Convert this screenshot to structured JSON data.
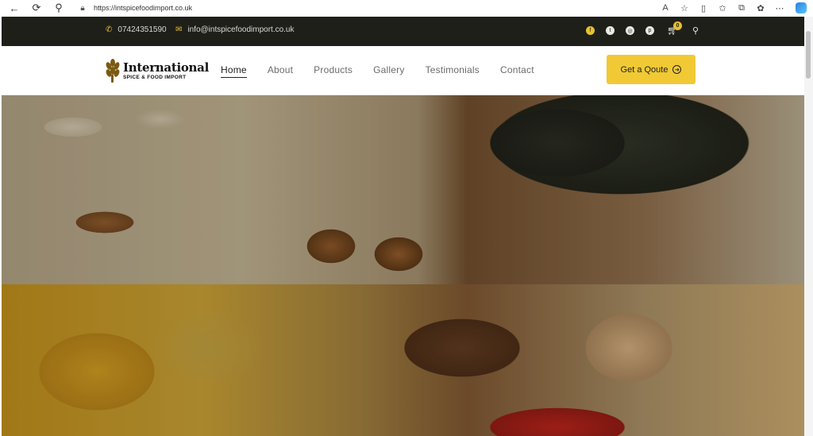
{
  "browser": {
    "url": "https://intspicefoodimport.co.uk",
    "icons": [
      "back-icon",
      "reload-icon",
      "search-icon",
      "lock-icon",
      "read-aloud-icon",
      "favorite-icon",
      "split-screen-icon",
      "favorites-icon",
      "collections-icon",
      "extensions-icon",
      "more-icon",
      "copilot-icon"
    ]
  },
  "topbar": {
    "phone": "07424351590",
    "email": "info@intspicefoodimport.co.uk",
    "cart_count": "0",
    "social": [
      "facebook-icon",
      "twitter-icon",
      "instagram-icon",
      "pinterest-icon"
    ]
  },
  "header": {
    "logo_title": "International",
    "logo_subtitle": "SPICE & FOOD IMPORT",
    "menu": [
      "Home",
      "About",
      "Products",
      "Gallery",
      "Testimonials",
      "Contact"
    ],
    "active_menu": "Home",
    "cta_label": "Get a Qoute"
  },
  "colors": {
    "accent": "#f0c935",
    "topbar_bg": "#1f1f1a"
  }
}
